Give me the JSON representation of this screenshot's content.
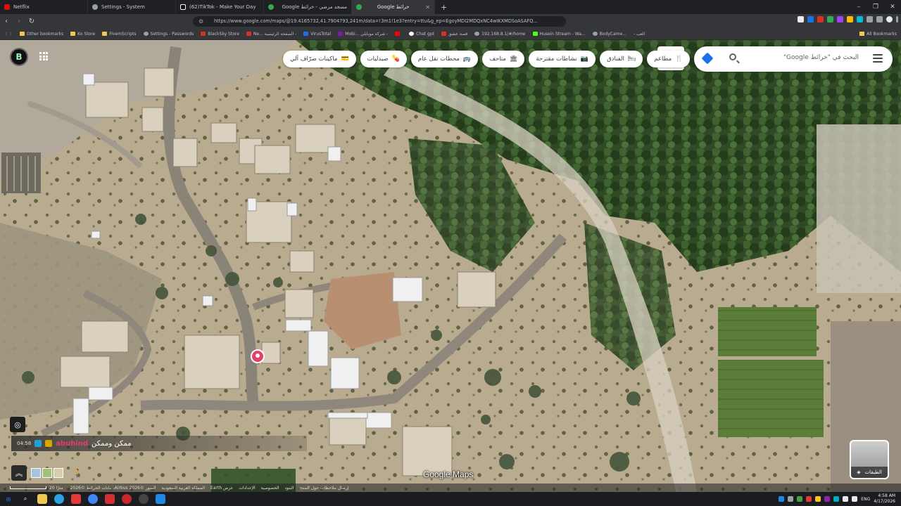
{
  "browser": {
    "tabs": [
      {
        "title": "Netflix",
        "color": "#e50914",
        "active": false
      },
      {
        "title": "Settings - System",
        "color": "#9aa0a6",
        "active": false
      },
      {
        "title": "(62)TikTok - Make Your Day",
        "color": "#ffffff",
        "active": false
      },
      {
        "title": "Google مسجد مرضي - خرائط",
        "color": "#34a853",
        "active": false
      },
      {
        "title": "Google خرائط",
        "color": "#34a853",
        "active": true
      }
    ],
    "url": "https://www.google.com/maps/@19.4165732,41.7904793,241m/data=!3m1!1e3?entry=ttu&g_ep=EgoyMDI2MDQxNC4wIKXMDSoASAFQ...",
    "bookmarks": [
      {
        "label": "Other bookmarks",
        "color": "#f2c94c"
      },
      {
        "label": "Ko Store",
        "color": "#f2c94c"
      },
      {
        "label": "FivemScripts",
        "color": "#f2c94c"
      },
      {
        "label": "Settings - Passwords",
        "color": "#9aa0a6"
      },
      {
        "label": "BlackSky Store",
        "color": "#d93025"
      },
      {
        "label": "Ne... الصفحة الرئيسية -",
        "color": "#d93025"
      },
      {
        "label": "VirusTotal",
        "color": "#1a73e8"
      },
      {
        "label": "Mobi... شركة موبايلي -",
        "color": "#7b1fa2"
      },
      {
        "label": "",
        "color": "#ff0000"
      },
      {
        "label": "Chat gpt",
        "color": "#ffffff"
      },
      {
        "label": "قصة عشق",
        "color": "#d93025"
      },
      {
        "label": "192.168.8.1/#/home",
        "color": "#9aa0a6"
      },
      {
        "label": "Husein Stream - Wa...",
        "color": "#53fc18"
      },
      {
        "label": "BodyCame...",
        "color": "#9aa0a6"
      },
      {
        "label": "- العب",
        "color": "#9aa0a6"
      }
    ],
    "all_bookmarks": "All Bookmarks"
  },
  "maps": {
    "search_placeholder": "البحث في \"خرائط Google\"",
    "lang_button": "ع",
    "chips": [
      {
        "label": "مطاعم",
        "icon": "🍴"
      },
      {
        "label": "الفنادق",
        "icon": "🛏"
      },
      {
        "label": "نشاطات مقترحة",
        "icon": "📷"
      },
      {
        "label": "متاحف",
        "icon": "🏛"
      },
      {
        "label": "محطات نقل عام",
        "icon": "🚌"
      },
      {
        "label": "صيدليات",
        "icon": "💊"
      },
      {
        "label": "ماكينات صرّاف آلي",
        "icon": "💳"
      }
    ],
    "layers_label": "الطبقات",
    "google_maps_watermark": "Google Maps",
    "scale_label": "20 مترًا",
    "footer_links": [
      "الصور ©2026 Airbus، بيانات الخرائط ©2026",
      "المملكة العربية السعودية",
      "عرض Earth",
      "الإعدادات",
      "الخصوصية",
      "البنود",
      "إرسال ملاحظات حول المنتج"
    ]
  },
  "chat_overlay": {
    "time": "04:58",
    "username": "abuhind",
    "message": "ممكن وممكن"
  },
  "taskbar": {
    "language": "ENG",
    "time": "4:58 AM",
    "date": "4/17/2026"
  },
  "colors": {
    "chrome_dark": "#202124",
    "accent_blue": "#1a73e8",
    "pin_red": "#e3416a"
  }
}
